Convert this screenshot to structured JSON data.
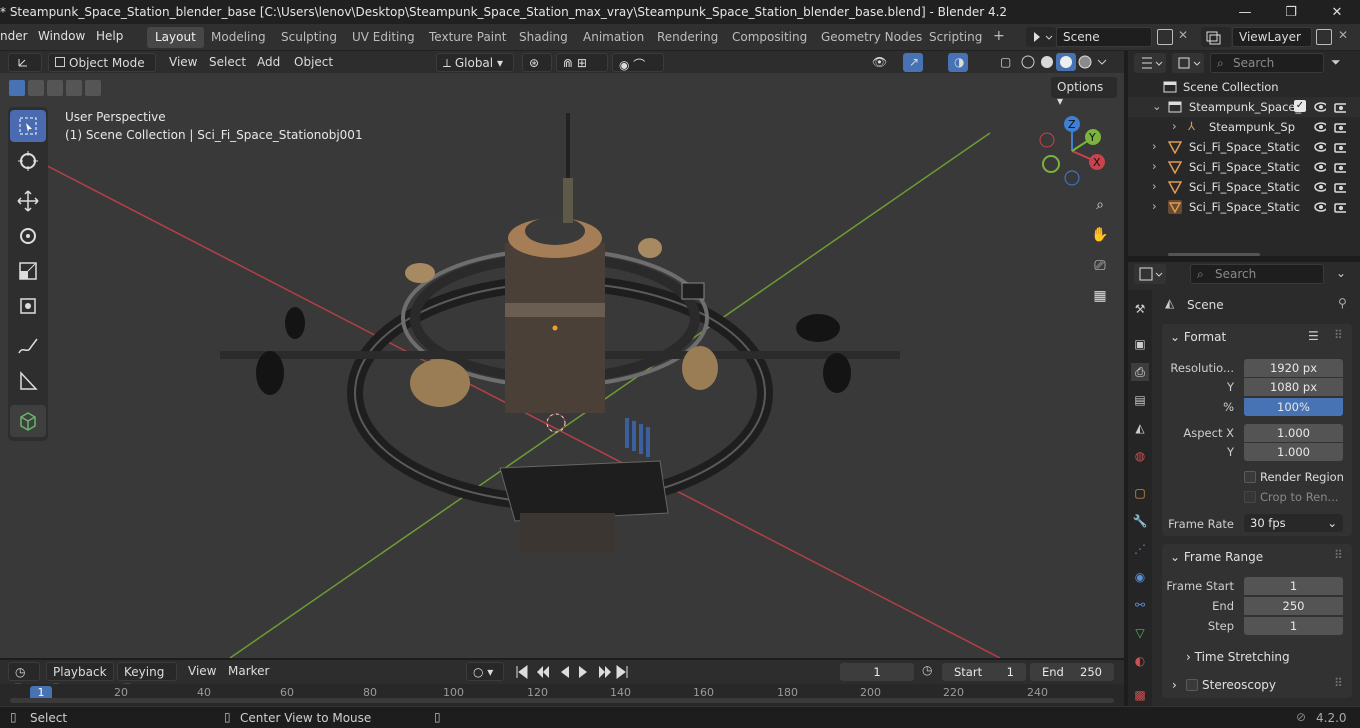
{
  "window": {
    "title": "* Steampunk_Space_Station_blender_base [C:\\Users\\lenov\\Desktop\\Steampunk_Space_Station_max_vray\\Steampunk_Space_Station_blender_base.blend] - Blender 4.2",
    "minimize": "—",
    "maximize": "❐",
    "close": "✕"
  },
  "menubar": {
    "items": [
      "nder",
      "Window",
      "Help"
    ],
    "workspaces": [
      "Layout",
      "Modeling",
      "Sculpting",
      "UV Editing",
      "Texture Paint",
      "Shading",
      "Animation",
      "Rendering",
      "Compositing",
      "Geometry Nodes",
      "Scripting"
    ],
    "active_workspace": "Layout",
    "add_tab": "+",
    "scene": "Scene",
    "view_layer": "ViewLayer"
  },
  "viewport_header": {
    "mode": "Object Mode",
    "menus": [
      "View",
      "Select",
      "Add",
      "Object"
    ],
    "transform_orientation": "Global",
    "options": "Options"
  },
  "viewport": {
    "perspective": "User Perspective",
    "context": "(1) Scene Collection | Sci_Fi_Space_Stationobj001",
    "gizmo": {
      "x": "X",
      "y": "Y",
      "z": "Z"
    }
  },
  "outliner": {
    "search_placeholder": "Search",
    "root": "Scene Collection",
    "items": [
      {
        "label": "Steampunk_Space_",
        "type": "collection"
      },
      {
        "label": "Steampunk_Sp",
        "type": "armature"
      },
      {
        "label": "Sci_Fi_Space_Static",
        "type": "mesh"
      },
      {
        "label": "Sci_Fi_Space_Static",
        "type": "mesh"
      },
      {
        "label": "Sci_Fi_Space_Static",
        "type": "mesh"
      },
      {
        "label": "Sci_Fi_Space_Static",
        "type": "mesh"
      }
    ]
  },
  "properties": {
    "search_placeholder": "Search",
    "context_title": "Scene",
    "format": {
      "header": "Format",
      "resolution_label": "Resolutio...",
      "resolution_x": "1920 px",
      "y_label": "Y",
      "resolution_y": "1080 px",
      "pct_label": "%",
      "resolution_pct": "100%",
      "aspect_x_label": "Aspect X",
      "aspect_x": "1.000",
      "aspect_y_label": "Y",
      "aspect_y": "1.000",
      "render_region": "Render Region",
      "crop": "Crop to Ren...",
      "frame_rate_label": "Frame Rate",
      "frame_rate": "30 fps"
    },
    "frame_range": {
      "header": "Frame Range",
      "start_label": "Frame Start",
      "start": "1",
      "end_label": "End",
      "end": "250",
      "step_label": "Step",
      "step": "1"
    },
    "time_stretching": "Time Stretching",
    "stereoscopy": "Stereoscopy"
  },
  "timeline": {
    "menus": [
      "Playback",
      "Keying",
      "View",
      "Marker"
    ],
    "current_frame": "1",
    "start_label": "Start",
    "start": "1",
    "end_label": "End",
    "end": "250",
    "ticks": [
      "1",
      "20",
      "40",
      "60",
      "80",
      "100",
      "120",
      "140",
      "160",
      "180",
      "200",
      "220",
      "240"
    ]
  },
  "statusbar": {
    "select": "Select",
    "center": "Center View to Mouse",
    "version": "4.2.0"
  },
  "colors": {
    "accent": "#4772b3",
    "x_axis": "#c9424d",
    "y_axis": "#7ab33d",
    "z_axis": "#3f7fd6"
  }
}
